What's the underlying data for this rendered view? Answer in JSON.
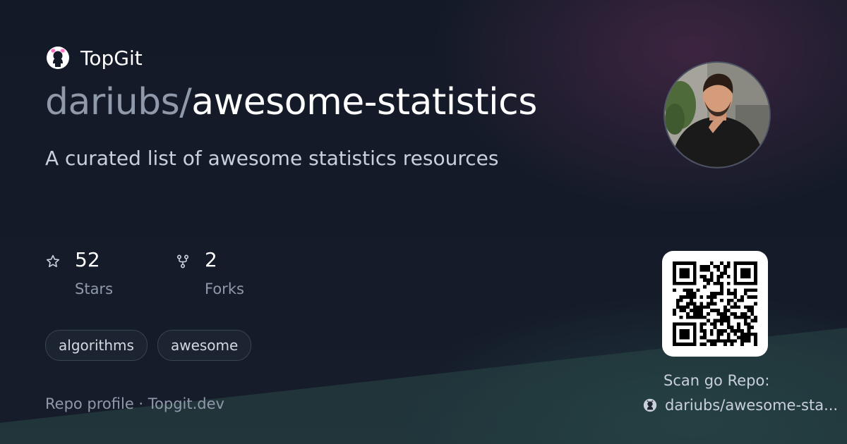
{
  "brand": {
    "name": "TopGit",
    "icon": "github-octocat-icon"
  },
  "repo": {
    "owner": "dariubs",
    "separator": "/",
    "name": "awesome-statistics",
    "description": "A curated list of awesome statistics resources"
  },
  "stats": [
    {
      "icon": "star-icon",
      "value": "52",
      "label": "Stars"
    },
    {
      "icon": "fork-icon",
      "value": "2",
      "label": "Forks"
    }
  ],
  "tags": [
    "algorithms",
    "awesome"
  ],
  "footer": {
    "text": "Repo profile · Topgit.dev"
  },
  "qr": {
    "caption": "Scan go Repo:",
    "link_icon": "github-icon",
    "link_text": "dariubs/awesome-sta..."
  },
  "colors": {
    "background": "#141a27",
    "muted_text": "#8f99aa",
    "primary_text": "#ffffff",
    "tag_border": "#3a4352"
  }
}
